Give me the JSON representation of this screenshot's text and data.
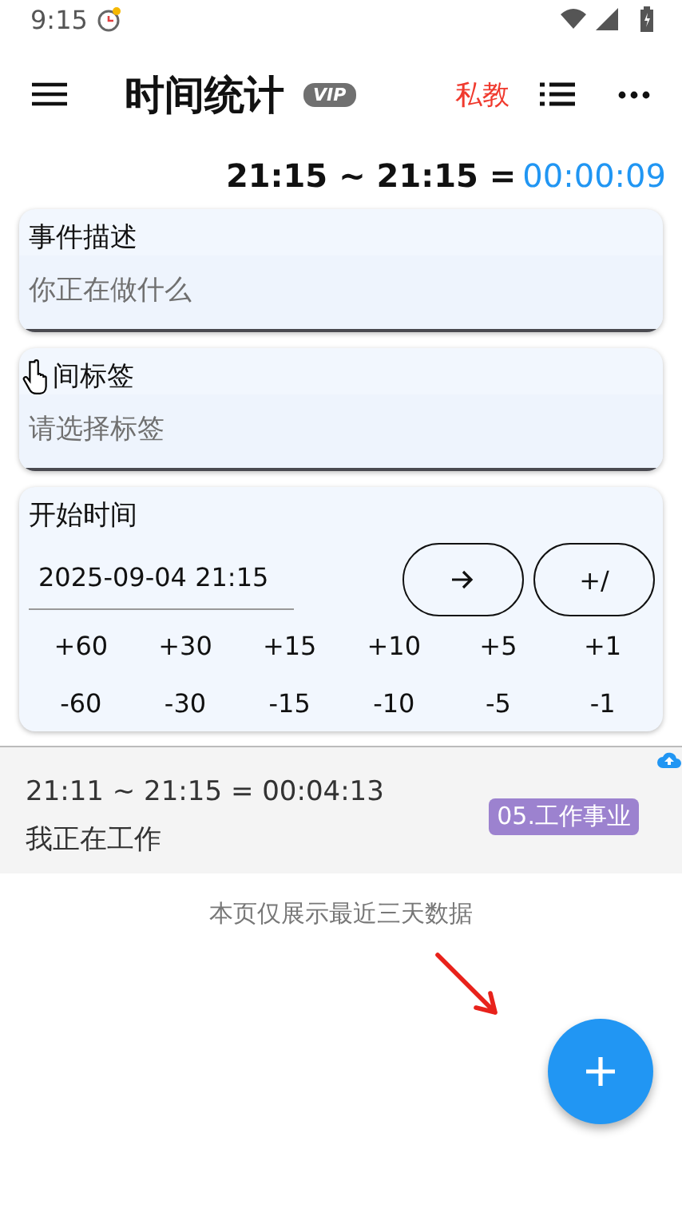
{
  "status_bar": {
    "time": "9:15"
  },
  "app_bar": {
    "title": "时间统计",
    "badge": "VIP",
    "action": "私教"
  },
  "timer": {
    "range": "21:15 ~ 21:15 =",
    "elapsed": "00:00:09"
  },
  "description": {
    "label": "事件描述",
    "placeholder": "你正在做什么"
  },
  "tag": {
    "label": "间标签",
    "placeholder": "请选择标签"
  },
  "start": {
    "label": "开始时间",
    "value": "2025-09-04 21:15",
    "buttons": [
      "+/"
    ],
    "steps": [
      [
        "+60",
        "+30",
        "+15",
        "+10",
        "+5",
        "+1"
      ],
      [
        "-60",
        "-30",
        "-15",
        "-10",
        "-5",
        "-1"
      ]
    ]
  },
  "records": [
    {
      "time": "21:11 ~ 21:15 = 00:04:13",
      "text": "我正在工作",
      "tag": "05.工作事业",
      "color": "#9c82cf"
    }
  ],
  "note": "本页仅展示最近三天数据"
}
